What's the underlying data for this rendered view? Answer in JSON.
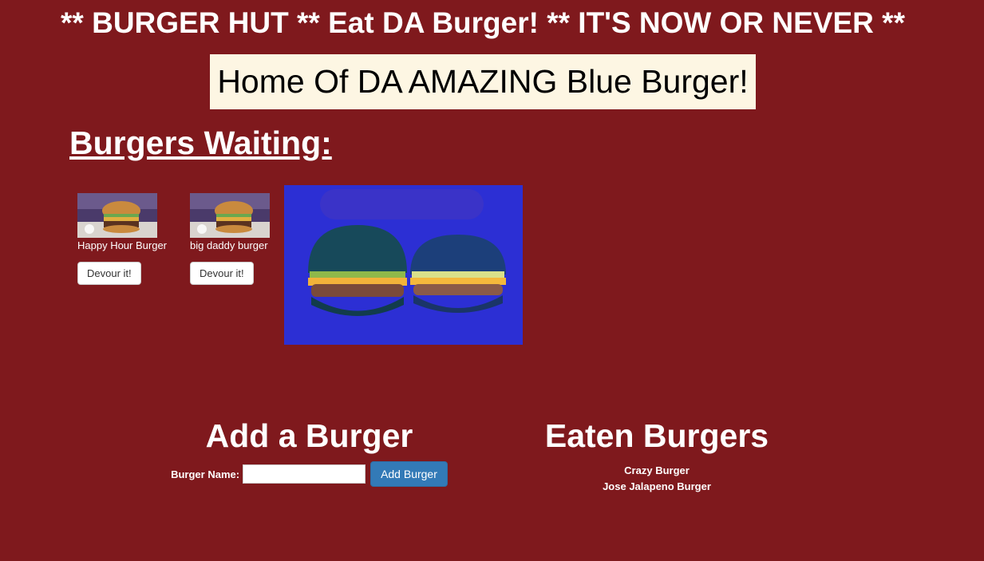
{
  "header": {
    "marquee": "** BURGER HUT ** Eat DA Burger! ** IT'S NOW OR NEVER **",
    "tagline": "Home Of DA AMAZING Blue Burger!"
  },
  "waiting": {
    "heading": "Burgers Waiting:",
    "burgers": [
      {
        "name": "Happy Hour Burger",
        "button_label": "Devour it!"
      },
      {
        "name": "big daddy burger",
        "button_label": "Devour it!"
      }
    ]
  },
  "add": {
    "heading": "Add a Burger",
    "label": "Burger Name:",
    "input_value": "",
    "input_placeholder": "",
    "button_label": "Add Burger"
  },
  "eaten": {
    "heading": "Eaten Burgers",
    "items": [
      "Crazy Burger",
      "Jose Jalapeno Burger"
    ]
  },
  "colors": {
    "background": "#7f191d",
    "tagline_bg": "#fdf6e3",
    "add_button": "#337ab7",
    "blue_burger_bg": "#2c2fd4"
  }
}
